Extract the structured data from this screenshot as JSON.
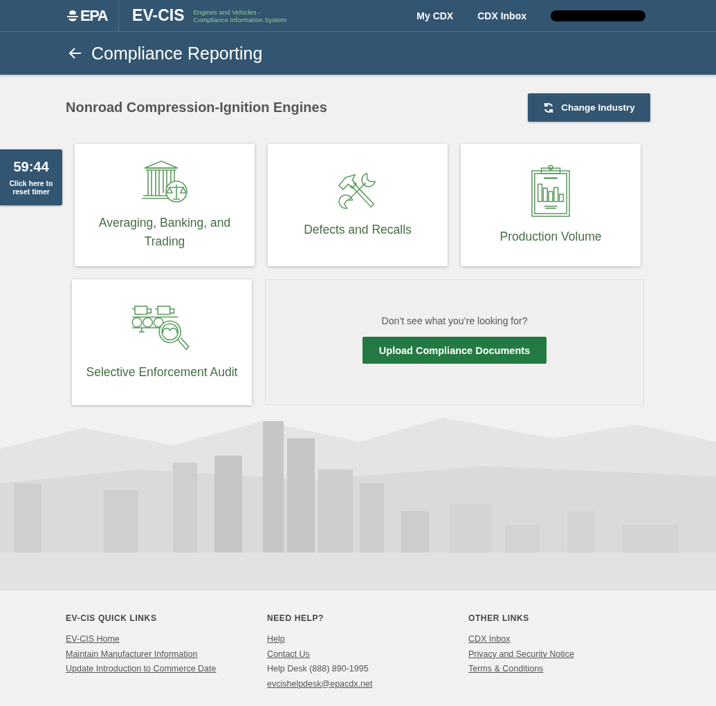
{
  "header": {
    "logo": "EPA",
    "app_name": "EV-CIS",
    "app_subtitle": [
      "Engines and Vehicles -",
      "Compliance Information System"
    ],
    "nav": [
      "My CDX",
      "CDX Inbox"
    ]
  },
  "page_title": "Compliance Reporting",
  "timer": {
    "time": "59:44",
    "label": "Click here to reset timer"
  },
  "industry": {
    "title": "Nonroad Compression-Ignition Engines",
    "button": "Change Industry"
  },
  "tiles": [
    {
      "kind": "trading",
      "label": "Averaging, Banking, and Trading"
    },
    {
      "kind": "recalls",
      "label": "Defects and Recalls"
    },
    {
      "kind": "volume",
      "label": "Production Volume"
    },
    {
      "kind": "audit",
      "label": "Selective Enforcement Audit"
    }
  ],
  "upload": {
    "prompt": "Don’t see what you’re looking for?",
    "button": "Upload Compliance Documents"
  },
  "footer": {
    "columns": [
      {
        "heading": "EV-CIS QUICK LINKS",
        "items": [
          {
            "kind": "link",
            "text": "EV-CIS Home"
          },
          {
            "kind": "link",
            "text": "Maintain Manufacturer Information"
          },
          {
            "kind": "link",
            "text": "Update Introduction to Commerce Date"
          }
        ]
      },
      {
        "heading": "NEED HELP?",
        "items": [
          {
            "kind": "link",
            "text": "Help"
          },
          {
            "kind": "link",
            "text": "Contact Us"
          },
          {
            "kind": "text",
            "text": "Help Desk (888) 890-1995"
          },
          {
            "kind": "link",
            "text": "evcishelpdesk@epacdx.net"
          }
        ]
      },
      {
        "heading": "OTHER LINKS",
        "items": [
          {
            "kind": "link",
            "text": "CDX Inbox"
          },
          {
            "kind": "link",
            "text": "Privacy and Security Notice"
          },
          {
            "kind": "link",
            "text": "Terms & Conditions"
          }
        ]
      }
    ]
  }
}
